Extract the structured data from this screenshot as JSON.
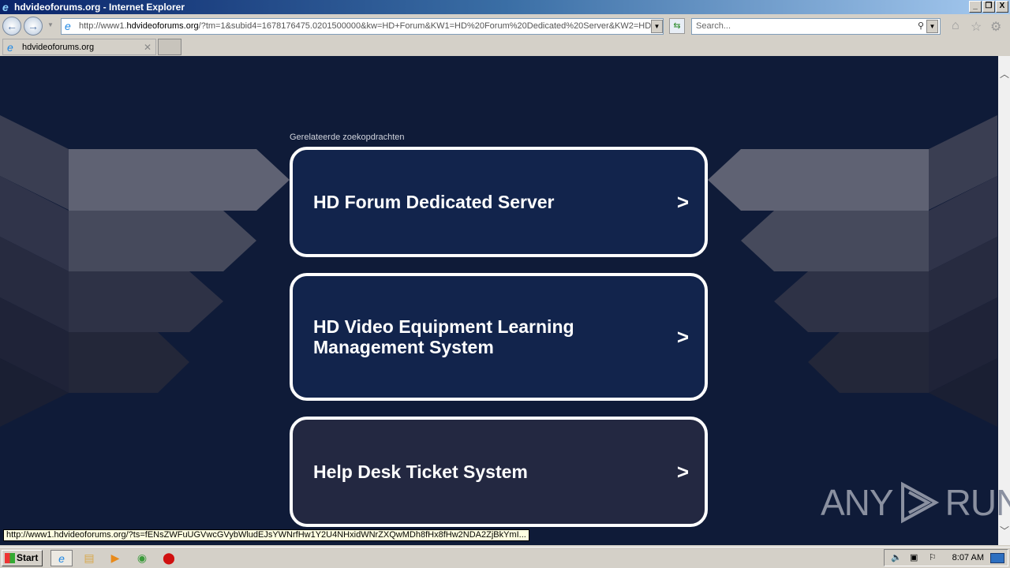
{
  "window": {
    "title": "hdvideoforums.org - Internet Explorer",
    "controls": [
      "_",
      "❐",
      "X"
    ]
  },
  "nav": {
    "address": {
      "prefix": "http://www1.",
      "domain": "hdvideoforums.org",
      "rest": "/?tm=1&subid4=1678176475.0201500000&kw=HD+Forum&KW1=HD%20Forum%20Dedicated%20Server&KW2=HD"
    },
    "search_placeholder": "Search..."
  },
  "tabs": [
    {
      "label": "hdvideoforums.org"
    }
  ],
  "page": {
    "related_label": "Gerelateerde zoekopdrachten",
    "cards": [
      {
        "label": "HD Forum Dedicated Server",
        "color": "#12244c"
      },
      {
        "label": "HD Video Equipment Learning Management System",
        "color": "#12244c"
      },
      {
        "label": "Help Desk Ticket System",
        "color": "#232841"
      }
    ],
    "background_color": "#0f1b38"
  },
  "status_url": "http://www1.hdvideoforums.org/?ts=fENsZWFuUGVwcGVybWludEJsYWNrfHw1Y2U4NHxidWNrZXQwMDh8fHx8fHw2NDA2ZjBkYmI...",
  "watermark": {
    "left": "ANY",
    "right": "RUN"
  },
  "taskbar": {
    "start_label": "Start",
    "clock": "8:07 AM"
  }
}
